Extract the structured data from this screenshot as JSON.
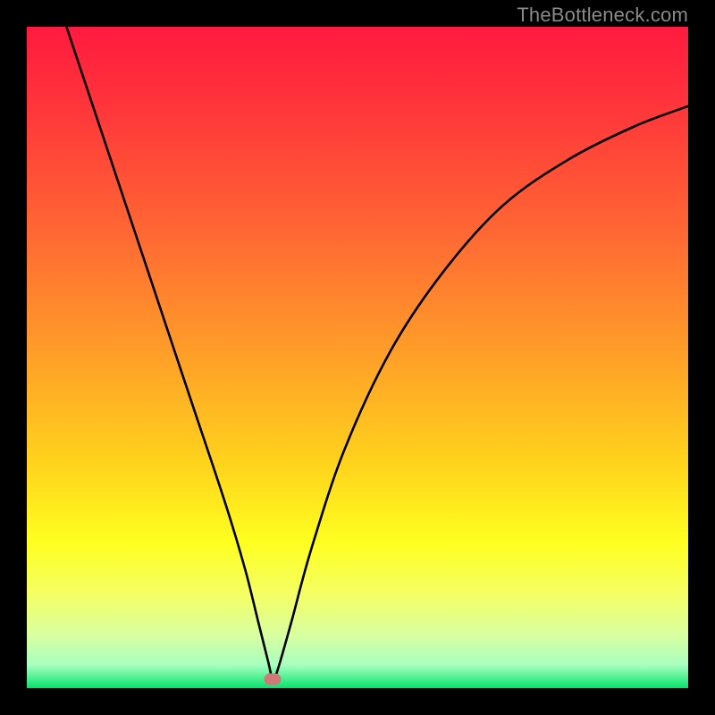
{
  "watermark": "TheBottleneck.com",
  "chart_data": {
    "type": "line",
    "title": "",
    "xlabel": "",
    "ylabel": "",
    "xlim": [
      0,
      100
    ],
    "ylim": [
      0,
      100
    ],
    "gradient_stops": [
      {
        "offset": 0.0,
        "color": "#ff1a3f"
      },
      {
        "offset": 0.14,
        "color": "#ff3a3a"
      },
      {
        "offset": 0.32,
        "color": "#ff6a33"
      },
      {
        "offset": 0.5,
        "color": "#ffa028"
      },
      {
        "offset": 0.66,
        "color": "#ffd31c"
      },
      {
        "offset": 0.78,
        "color": "#ffff20"
      },
      {
        "offset": 0.86,
        "color": "#f4ff66"
      },
      {
        "offset": 0.92,
        "color": "#d8ffa0"
      },
      {
        "offset": 0.965,
        "color": "#a8ffc0"
      },
      {
        "offset": 0.985,
        "color": "#4cf090"
      },
      {
        "offset": 1.0,
        "color": "#04e36a"
      }
    ],
    "series": [
      {
        "name": "bottleneck-curve",
        "x": [
          6,
          10,
          15,
          20,
          25,
          30,
          33,
          35,
          36.5,
          37.2,
          38,
          40,
          43,
          48,
          55,
          63,
          72,
          82,
          92,
          100
        ],
        "y": [
          100,
          88,
          73,
          58,
          43,
          28,
          18,
          10,
          4,
          1.3,
          3,
          10,
          21,
          36,
          51,
          63,
          73,
          80,
          85,
          88
        ]
      }
    ],
    "marker": {
      "x": 37.2,
      "y": 1.3,
      "color": "#cf7a79"
    }
  }
}
